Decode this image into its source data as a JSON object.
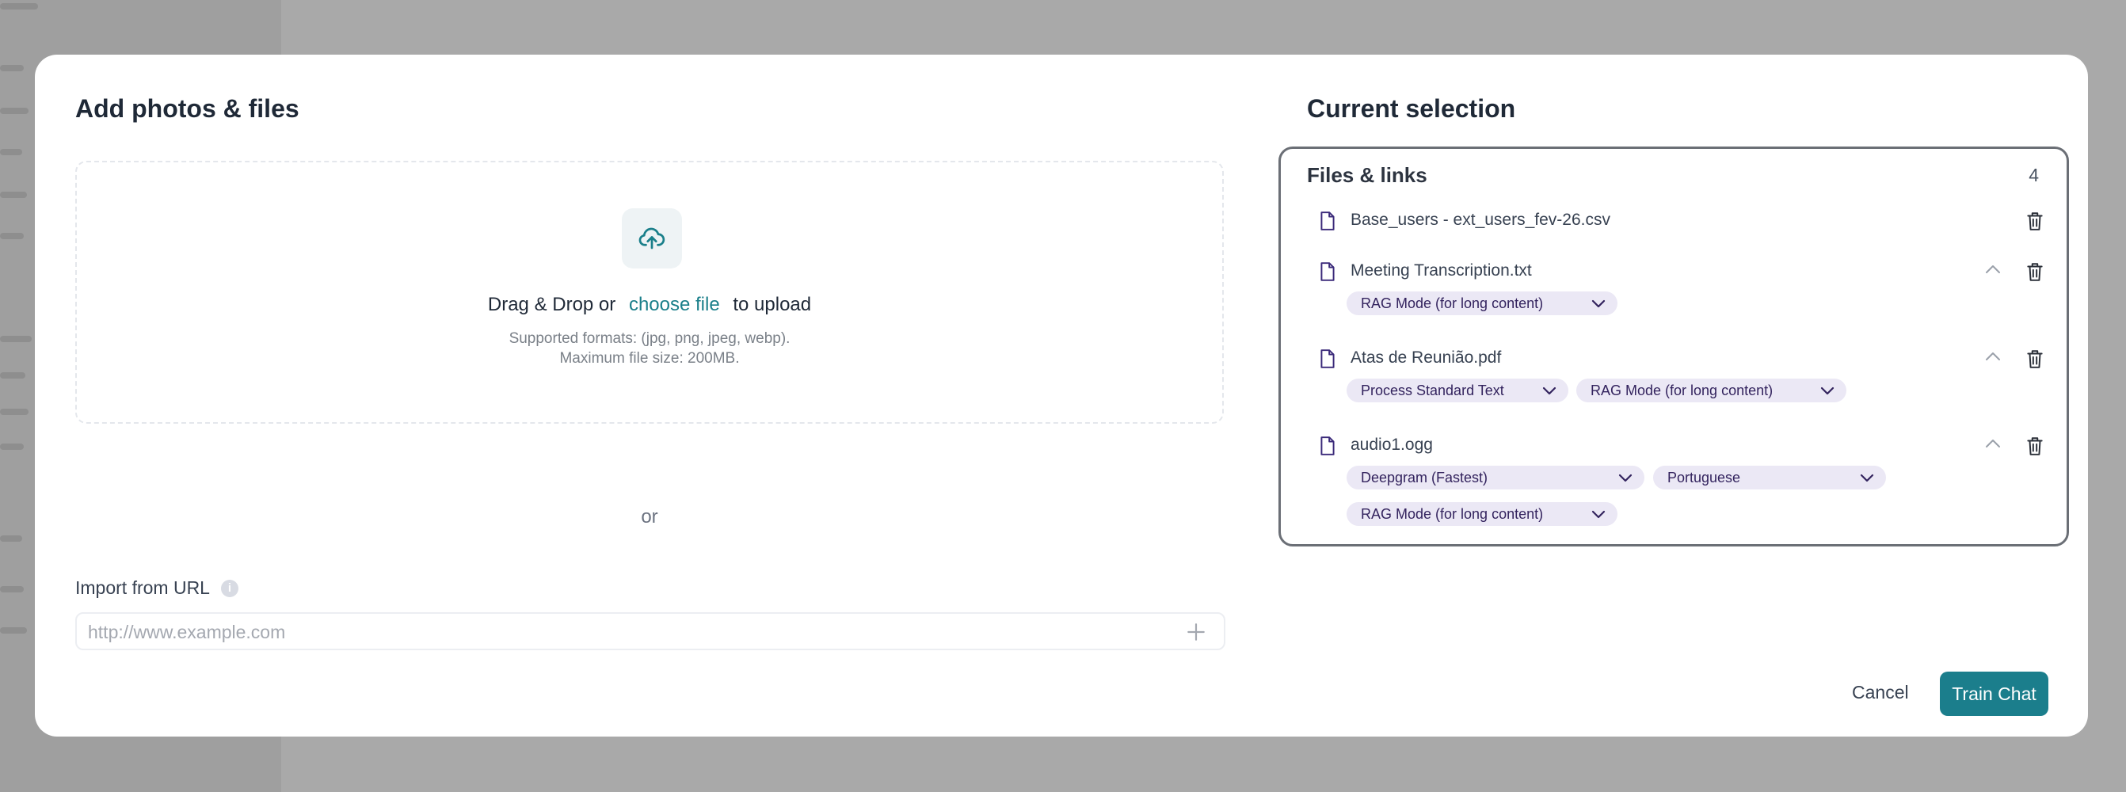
{
  "left": {
    "title": "Add photos & files",
    "dropzone": {
      "drag_text": "Drag & Drop or",
      "choose_file": "choose file",
      "to_upload": "to upload",
      "formats": "Supported formats: (jpg, png, jpeg, webp).",
      "max_size": "Maximum file size: 200MB."
    },
    "or": "or",
    "import_url": {
      "label": "Import from URL",
      "placeholder": "http://www.example.com"
    }
  },
  "right": {
    "title": "Current selection",
    "section_title": "Files & links",
    "count": "4",
    "files": [
      {
        "name": "Base_users - ext_users_fev-26.csv",
        "options": []
      },
      {
        "name": "Meeting Transcription.txt",
        "options": [
          "RAG Mode (for long content)"
        ]
      },
      {
        "name": "Atas de Reunião.pdf",
        "options": [
          "Process Standard Text",
          "RAG Mode (for long content)"
        ]
      },
      {
        "name": "audio1.ogg",
        "options": [
          "Deepgram (Fastest)",
          "Portuguese",
          "RAG Mode (for long content)"
        ]
      }
    ]
  },
  "footer": {
    "cancel": "Cancel",
    "train": "Train Chat"
  },
  "colors": {
    "accent": "#1b7e8c",
    "link": "#1a7f8a",
    "pill_bg": "#ebe8f5",
    "pill_text": "#33235e",
    "file_icon": "#3b2a7a"
  }
}
